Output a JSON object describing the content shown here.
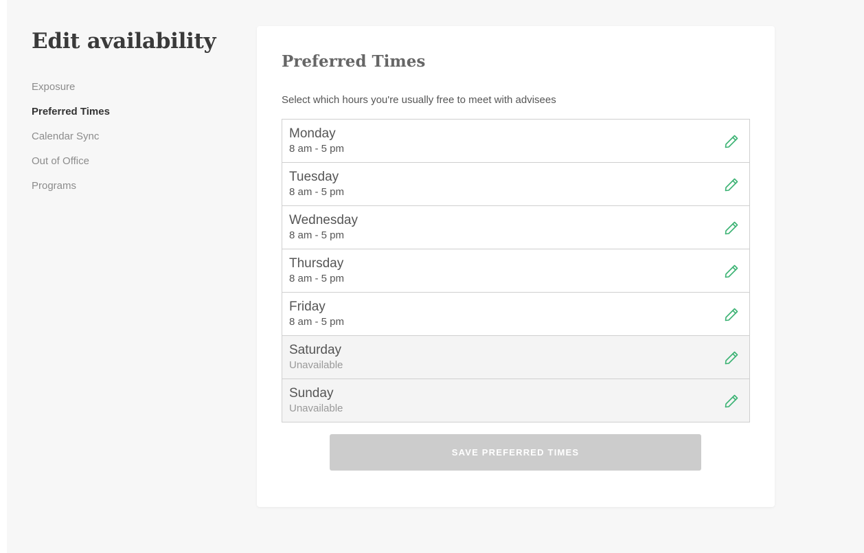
{
  "page": {
    "title": "Edit availability"
  },
  "sidebar": {
    "items": [
      {
        "label": "Exposure",
        "active": false
      },
      {
        "label": "Preferred Times",
        "active": true
      },
      {
        "label": "Calendar Sync",
        "active": false
      },
      {
        "label": "Out of Office",
        "active": false
      },
      {
        "label": "Programs",
        "active": false
      }
    ]
  },
  "card": {
    "title": "Preferred Times",
    "description": "Select which hours you're usually free to meet with advisees",
    "days": [
      {
        "name": "Monday",
        "hours": "8 am - 5 pm",
        "available": true
      },
      {
        "name": "Tuesday",
        "hours": "8 am - 5 pm",
        "available": true
      },
      {
        "name": "Wednesday",
        "hours": "8 am - 5 pm",
        "available": true
      },
      {
        "name": "Thursday",
        "hours": "8 am - 5 pm",
        "available": true
      },
      {
        "name": "Friday",
        "hours": "8 am - 5 pm",
        "available": true
      },
      {
        "name": "Saturday",
        "hours": "Unavailable",
        "available": false
      },
      {
        "name": "Sunday",
        "hours": "Unavailable",
        "available": false
      }
    ],
    "edit_icon": "pencil-icon",
    "save_label": "SAVE PREFERRED TIMES"
  },
  "colors": {
    "accent_green": "#3bb273",
    "save_button_disabled": "#cccccc",
    "unavailable_row_bg": "#f4f4f4"
  }
}
